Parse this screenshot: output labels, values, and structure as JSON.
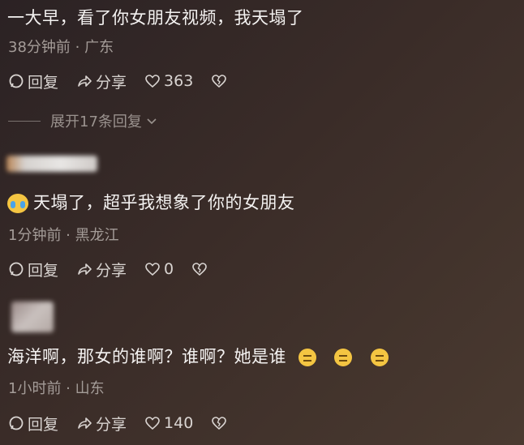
{
  "comments": [
    {
      "text": "一大早，看了你女朋友视频，我天塌了",
      "meta": "38分钟前 · 广东",
      "reply_label": "回复",
      "share_label": "分享",
      "likes": "363",
      "expand_label": "展开17条回复"
    },
    {
      "text": "天塌了，超乎我想象了你的女朋友",
      "leading_emoji": "crying-face-icon",
      "meta": "1分钟前 · 黑龙江",
      "reply_label": "回复",
      "share_label": "分享",
      "likes": "0"
    },
    {
      "text": "海洋啊，那女的谁啊？谁啊？她是谁",
      "trailing_emojis": [
        "stare-face-icon",
        "dizzy-face-icon",
        "pleading-face-icon"
      ],
      "meta": "1小时前 · 山东",
      "reply_label": "回复",
      "share_label": "分享",
      "likes": "140"
    }
  ],
  "colors": {
    "background": "#2f2626",
    "text": "#f4f2f1",
    "meta": "#a49c98",
    "action": "#d9d4d1"
  }
}
